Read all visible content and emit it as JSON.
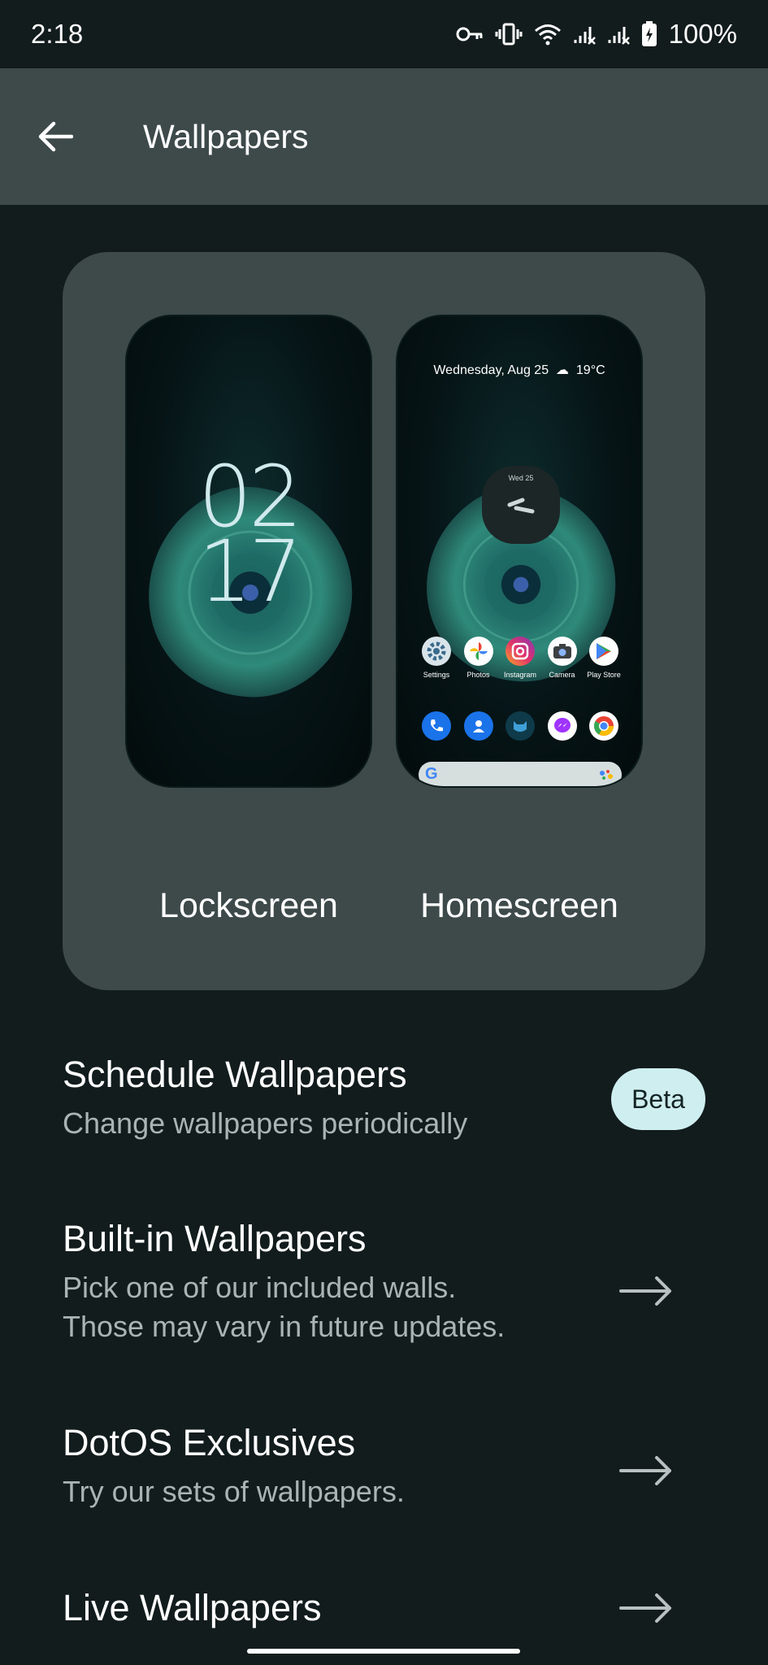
{
  "status_bar": {
    "time": "2:18",
    "battery": "100%"
  },
  "app_bar": {
    "title": "Wallpapers",
    "back_icon": "arrow-left-icon"
  },
  "preview": {
    "lockscreen": {
      "label": "Lockscreen",
      "clock_hour": "02",
      "clock_minute": "17"
    },
    "homescreen": {
      "label": "Homescreen",
      "date": "Wednesday, Aug 25",
      "weather": "19°C",
      "widget_date": "Wed 25",
      "apps_row1": [
        {
          "label": "Settings",
          "icon": "settings-icon",
          "color": "#3a6b8c"
        },
        {
          "label": "Photos",
          "icon": "photos-icon",
          "color": "#ffffff"
        },
        {
          "label": "Instagram",
          "icon": "instagram-icon",
          "color": "#d6249f"
        },
        {
          "label": "Camera",
          "icon": "camera-icon",
          "color": "#ffffff"
        },
        {
          "label": "Play Store",
          "icon": "play-store-icon",
          "color": "#ffffff"
        }
      ],
      "apps_row2": [
        {
          "icon": "phone-icon",
          "color": "#1a73e8"
        },
        {
          "icon": "contacts-icon",
          "color": "#1a73e8"
        },
        {
          "icon": "cat-icon",
          "color": "#0e3a4a"
        },
        {
          "icon": "messenger-icon",
          "color": "#ffffff"
        },
        {
          "icon": "chrome-icon",
          "color": "#ffffff"
        }
      ]
    }
  },
  "items": [
    {
      "title": "Schedule Wallpapers",
      "subtitle": "Change wallpapers periodically",
      "badge": "Beta"
    },
    {
      "title": "Built-in Wallpapers",
      "subtitle_line1": "Pick one of our included walls.",
      "subtitle_line2": "Those may vary in future updates."
    },
    {
      "title": "DotOS Exclusives",
      "subtitle": "Try our sets of wallpapers."
    },
    {
      "title": "Live Wallpapers"
    }
  ],
  "colors": {
    "background": "#131c1d",
    "surface": "#3e4a4a",
    "accent": "#cfeef0"
  }
}
